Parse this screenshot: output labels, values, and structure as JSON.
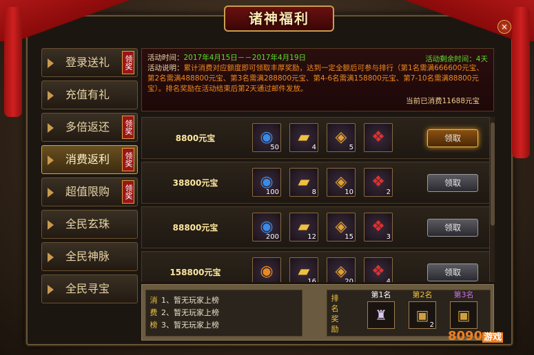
{
  "title": "诸神福利",
  "close": "×",
  "sidebar": [
    {
      "label": "登录送礼",
      "badge": "领奖",
      "active": false
    },
    {
      "label": "充值有礼",
      "badge": "",
      "active": false
    },
    {
      "label": "多倍返还",
      "badge": "领奖",
      "active": false
    },
    {
      "label": "消费返利",
      "badge": "领奖",
      "active": true
    },
    {
      "label": "超值限购",
      "badge": "领奖",
      "active": false
    },
    {
      "label": "全民玄珠",
      "badge": "",
      "active": false
    },
    {
      "label": "全民神脉",
      "badge": "",
      "active": false
    },
    {
      "label": "全民寻宝",
      "badge": "",
      "active": false
    }
  ],
  "info": {
    "time_label": "活动时间：",
    "time_value": "2017年4月15日－－2017年4月19日",
    "remaining": "活动剩余时间：4天",
    "desc_label": "活动说明：",
    "desc_text": "累计消费对应额度即可领取丰厚奖励，达到一定全额后可参与排行（第1名需满666600元宝、第2名需满488800元宝、第3名需满288800元宝、第4-6名需满158800元宝、第7-10名需满88800元宝）。排名奖励在活动结束后第2天通过邮件发放。",
    "spent": "当前已消费11688元宝"
  },
  "rows": [
    {
      "need": "8800元宝",
      "items": [
        {
          "icon": "orb",
          "count": "50"
        },
        {
          "icon": "gold-bars",
          "count": "4"
        },
        {
          "icon": "token",
          "count": "5"
        },
        {
          "icon": "red-gem",
          "count": ""
        }
      ],
      "button": "领取",
      "hot": true
    },
    {
      "need": "38800元宝",
      "items": [
        {
          "icon": "orb",
          "count": "100"
        },
        {
          "icon": "gold-bars",
          "count": "8"
        },
        {
          "icon": "token",
          "count": "10"
        },
        {
          "icon": "red-gem",
          "count": "2"
        }
      ],
      "button": "领取",
      "hot": false
    },
    {
      "need": "88800元宝",
      "items": [
        {
          "icon": "orb",
          "count": "200"
        },
        {
          "icon": "gold-bars",
          "count": "12"
        },
        {
          "icon": "token",
          "count": "15"
        },
        {
          "icon": "red-gem",
          "count": "3"
        }
      ],
      "button": "领取",
      "hot": false
    },
    {
      "need": "158800元宝",
      "items": [
        {
          "icon": "orange-orb",
          "count": ""
        },
        {
          "icon": "gold-bars",
          "count": "16"
        },
        {
          "icon": "token",
          "count": "20"
        },
        {
          "icon": "red-gem",
          "count": "4"
        }
      ],
      "button": "领取",
      "hot": false
    }
  ],
  "rank": {
    "title_chars": "消费榜",
    "entries": [
      "1、暂无玩家上榜",
      "2、暂无玩家上榜",
      "3、暂无玩家上榜"
    ],
    "reward_title_chars": "排名奖励",
    "prizes": [
      {
        "label": "第1名",
        "color": "#ffffff",
        "icon": "robe",
        "count": ""
      },
      {
        "label": "第2名",
        "color": "#f0c040",
        "icon": "chest",
        "count": "2"
      },
      {
        "label": "第3名",
        "color": "#d070f0",
        "icon": "chest",
        "count": ""
      }
    ]
  },
  "watermark": {
    "text": "8090",
    "suffix": "游戏"
  }
}
